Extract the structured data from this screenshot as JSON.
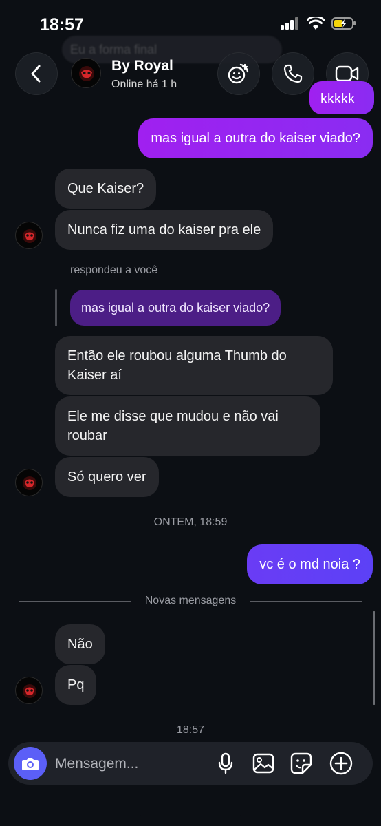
{
  "status": {
    "time": "18:57"
  },
  "header": {
    "ghost_text": "Eu a forma final",
    "contact_name": "By Royal",
    "presence": "Online há 1 h"
  },
  "messages": {
    "out_kkk": "kkkkk",
    "out_kaiser": "mas igual a outra do kaiser viado?",
    "in_que_kaiser": "Que Kaiser?",
    "in_nunca": "Nunca fiz uma do kaiser pra ele",
    "reply_label": "respondeu a você",
    "reply_quote": "mas igual a outra do kaiser viado?",
    "in_entao": "Então ele roubou alguma Thumb do Kaiser aí",
    "in_ele_disse": "Ele me disse que mudou e não vai roubar",
    "in_so_quero": "Só quero ver",
    "timestamp_ontem": "ONTEM, 18:59",
    "out_md_noia": "vc é o md noia ?",
    "new_messages_label": "Novas mensagens",
    "in_nao": "Não",
    "in_pq": "Pq",
    "timestamp_now": "18:57"
  },
  "composer": {
    "placeholder": "Mensagem..."
  },
  "colors": {
    "background": "#0c0f14",
    "incoming_bubble": "#26272c",
    "outgoing_bubble": "#a020f0",
    "outgoing_bubble_blue": "#5c41f6",
    "reply_bubble": "#4c1e86",
    "camera_button": "#5b5ff7"
  },
  "icons": [
    "back-icon",
    "gif-sticker-icon",
    "phone-icon",
    "video-icon",
    "camera-icon",
    "microphone-icon",
    "gallery-icon",
    "sticker-icon",
    "plus-icon"
  ]
}
